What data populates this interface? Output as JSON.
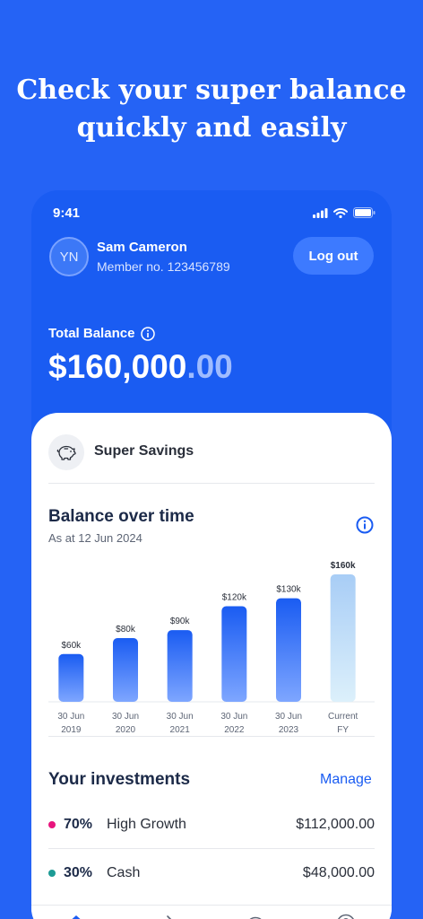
{
  "headline": {
    "line1": "Check your super balance",
    "line2": "quickly and easily"
  },
  "status_bar": {
    "time": "9:41"
  },
  "user": {
    "initials": "YN",
    "name": "Sam Cameron",
    "member_no": "Member no. 123456789"
  },
  "header": {
    "logout_label": "Log out"
  },
  "balance": {
    "label": "Total Balance",
    "amount": "$160,000",
    "cents": ".00"
  },
  "account": {
    "name": "Super Savings",
    "icon": "piggy-bank-icon"
  },
  "balance_chart": {
    "title": "Balance over time",
    "subtitle": "As at 12 Jun 2024"
  },
  "chart_data": {
    "type": "bar",
    "categories": [
      "30 Jun 2019",
      "30 Jun 2020",
      "30 Jun 2021",
      "30 Jun 2022",
      "30 Jun 2023",
      "Current FY"
    ],
    "tick_lines": [
      [
        "30 Jun",
        "2019"
      ],
      [
        "30 Jun",
        "2020"
      ],
      [
        "30 Jun",
        "2021"
      ],
      [
        "30 Jun",
        "2022"
      ],
      [
        "30 Jun",
        "2023"
      ],
      [
        "Current",
        "FY"
      ]
    ],
    "values": [
      60000,
      80000,
      90000,
      120000,
      130000,
      160000
    ],
    "value_labels": [
      "$60k",
      "$80k",
      "$90k",
      "$120k",
      "$130k",
      "$160k"
    ],
    "ylim": [
      0,
      160000
    ],
    "grid": false,
    "colors": {
      "bar_top": "#1a5cf2",
      "bar_bottom": "#7ea6ff",
      "current_top": "#a8cdf6",
      "current_bottom": "#dcf0fb"
    }
  },
  "investments": {
    "title": "Your investments",
    "manage_label": "Manage",
    "items": [
      {
        "pct": "70%",
        "name": "High Growth",
        "amount": "$112,000.00",
        "color": "#e8157d"
      },
      {
        "pct": "30%",
        "name": "Cash",
        "amount": "$48,000.00",
        "color": "#1d9b95"
      }
    ]
  },
  "nav": {
    "items": [
      {
        "icon": "home-icon",
        "active": true
      },
      {
        "icon": "transfer-icon",
        "active": false
      },
      {
        "icon": "piggy-bank-icon",
        "active": false
      },
      {
        "icon": "help-icon",
        "active": false
      }
    ]
  },
  "colors": {
    "brand": "#1a5cf2",
    "background": "#2563f5"
  }
}
